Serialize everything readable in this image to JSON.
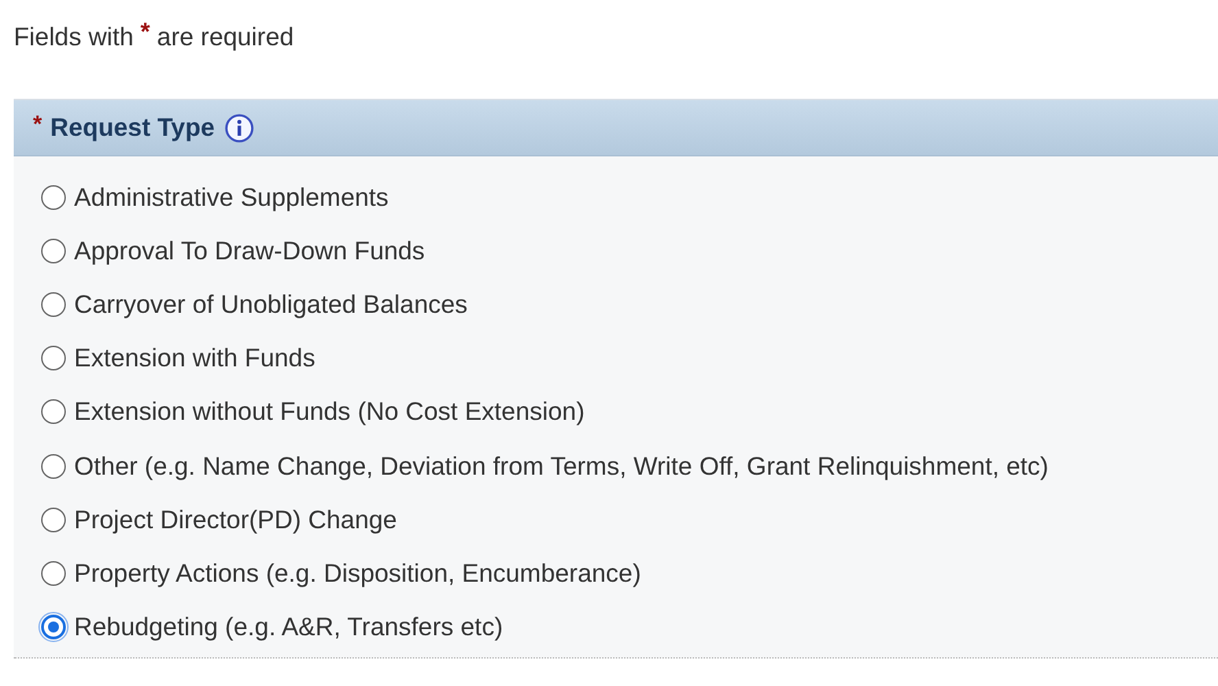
{
  "intro": {
    "before": "Fields with",
    "mark": "*",
    "after": "are required"
  },
  "section": {
    "required_mark": "*",
    "title": "Request Type",
    "options": [
      {
        "label": "Administrative Supplements",
        "selected": false
      },
      {
        "label": "Approval To Draw-Down Funds",
        "selected": false
      },
      {
        "label": "Carryover of Unobligated Balances",
        "selected": false
      },
      {
        "label": "Extension with Funds",
        "selected": false
      },
      {
        "label": "Extension without Funds (No Cost Extension)",
        "selected": false
      },
      {
        "label": "Other (e.g. Name Change, Deviation from Terms, Write Off, Grant Relinquishment, etc)",
        "selected": false
      },
      {
        "label": "Project Director(PD) Change",
        "selected": false
      },
      {
        "label": "Property Actions (e.g. Disposition, Encumberance)",
        "selected": false
      },
      {
        "label": "Rebudgeting (e.g. A&R, Transfers etc)",
        "selected": true
      }
    ]
  }
}
